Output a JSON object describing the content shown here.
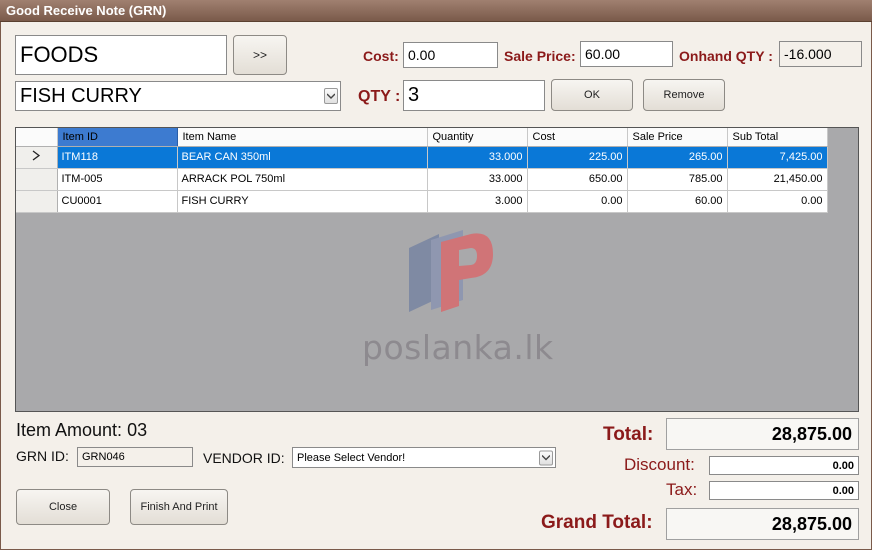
{
  "window": {
    "title": "Good Receive Note (GRN)"
  },
  "category": {
    "value": "FOODS",
    "next_label": ">>"
  },
  "pricing": {
    "cost_label": "Cost:",
    "cost_value": "0.00",
    "sale_price_label": "Sale Price:",
    "sale_price_value": "60.00",
    "onhand_label": "Onhand QTY :",
    "onhand_value": "-16.000"
  },
  "item_select": {
    "value": "FISH CURRY"
  },
  "qty": {
    "label": "QTY :",
    "value": "3"
  },
  "buttons": {
    "ok": "OK",
    "remove": "Remove",
    "close": "Close",
    "finish_print": "Finish And Print"
  },
  "grid": {
    "columns": [
      "Item ID",
      "Item Name",
      "Quantity",
      "Cost",
      "Sale Price",
      "Sub Total"
    ],
    "rows": [
      [
        "ITM118",
        "BEAR CAN 350ml",
        "33.000",
        "225.00",
        "265.00",
        "7,425.00"
      ],
      [
        "ITM-005",
        "ARRACK POL 750ml",
        "33.000",
        "650.00",
        "785.00",
        "21,450.00"
      ],
      [
        "CU0001",
        "FISH CURRY",
        "3.000",
        "0.00",
        "60.00",
        "0.00"
      ]
    ],
    "selected_row": 0,
    "colors": {
      "selection": "#0a78d7",
      "background": "#a9a9ab"
    }
  },
  "watermark": {
    "text": "poslanka.lk"
  },
  "footer": {
    "item_amount_label": "Item Amount:",
    "item_amount_value": "03",
    "grn_label": "GRN ID:",
    "grn_value": "GRN046",
    "vendor_label": "VENDOR ID:",
    "vendor_value": "Please Select Vendor!"
  },
  "totals": {
    "total_label": "Total:",
    "total_value": "28,875.00",
    "discount_label": "Discount:",
    "discount_value": "0.00",
    "tax_label": "Tax:",
    "tax_value": "0.00",
    "grand_total_label": "Grand Total:",
    "grand_total_value": "28,875.00"
  },
  "theme": {
    "label_red": "#8b1a1a",
    "title_bar": "#8a6a5a"
  }
}
